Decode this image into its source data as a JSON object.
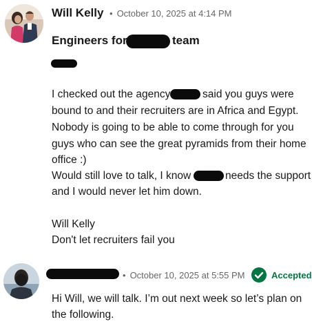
{
  "message1": {
    "sender": "Will Kelly",
    "timestamp": "October 10, 2025 at 4:14 PM",
    "subject_prefix": "Engineers for",
    "subject_suffix": "team",
    "body_lines": [
      "I checked out the agency",
      "said you guys were",
      "bound to and their recruiters are in Africa and Egypt.",
      "Nobody is going to be able to come through for you",
      "guys who can see the great pyramids from their home",
      "office :)",
      "Would still love to talk, I know",
      "needs the support",
      "and I would never let him down.",
      "Will Kelly",
      "Don't let recruiters fail you"
    ]
  },
  "message2": {
    "timestamp": "October 10, 2025 at 5:55 PM",
    "status": "Accepted",
    "body_lines": [
      "Hi Will, we will talk. I’m out next week so let’s plan on",
      "the following."
    ]
  },
  "colors": {
    "accepted_green": "#057642",
    "meta_gray": "#666666",
    "text": "#191919"
  },
  "icons": [
    "accepted-check-icon"
  ]
}
